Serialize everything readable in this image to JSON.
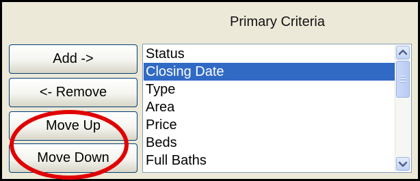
{
  "criteria": {
    "heading": "Primary Criteria",
    "buttons": {
      "add": "Add ->",
      "remove": "<- Remove",
      "move_up": "Move Up",
      "move_down": "Move Down"
    },
    "list": {
      "items": [
        "Status",
        "Closing Date",
        "Type",
        "Area",
        "Price",
        "Beds",
        "Full Baths"
      ],
      "selected": "Closing Date"
    },
    "scrollbar": {
      "up_icon": "scroll-up-arrow-icon",
      "down_icon": "scroll-down-arrow-icon"
    }
  },
  "colors": {
    "selection": "#316ac5",
    "annotation": "#e00000",
    "panel": "#ece9d8"
  }
}
